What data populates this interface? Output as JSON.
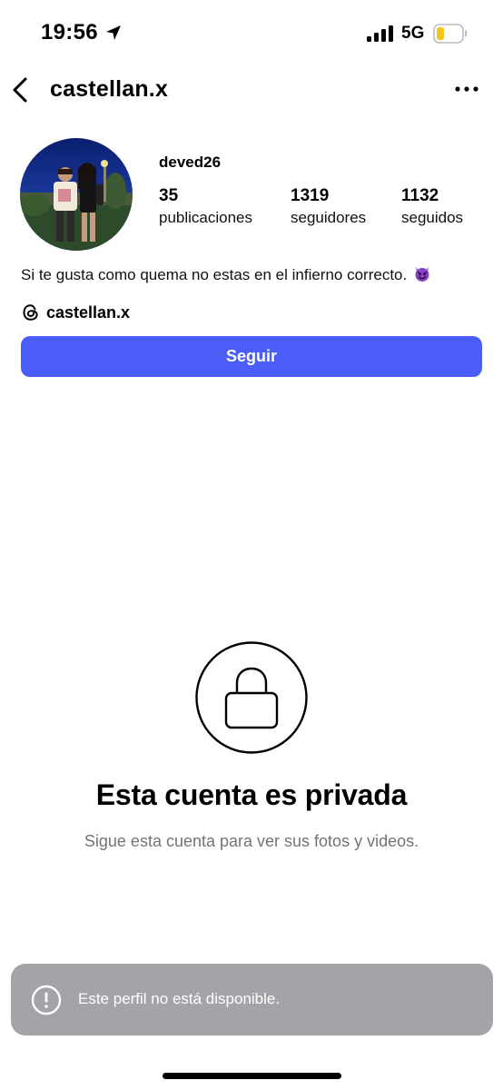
{
  "status_bar": {
    "time": "19:56",
    "network": "5G",
    "icons": [
      "location-arrow-icon",
      "cellular-signal-icon",
      "battery-low-icon"
    ]
  },
  "header": {
    "username": "castellan.x",
    "icons": [
      "chevron-left-icon",
      "more-horizontal-icon"
    ]
  },
  "profile": {
    "display_name": "deved26",
    "stats": [
      {
        "value": "35",
        "label": "publicaciones"
      },
      {
        "value": "1319",
        "label": "seguidores"
      },
      {
        "value": "1132",
        "label": "seguidos"
      }
    ],
    "bio": "Si te gusta como quema no estas en el infierno correcto.",
    "bio_emoji": "😈",
    "threads_handle": "castellan.x",
    "follow_label": "Seguir"
  },
  "private": {
    "title": "Esta cuenta es privada",
    "subtitle": "Sigue esta cuenta para ver sus fotos y videos."
  },
  "toast": {
    "message": "Este perfil no está disponible."
  },
  "colors": {
    "accent": "#4a5df9",
    "toast_bg": "#a2a4a8",
    "secondary_text": "#73737a",
    "battery_fill": "#f7c31a",
    "devil_emoji": "#8a3fc4"
  }
}
